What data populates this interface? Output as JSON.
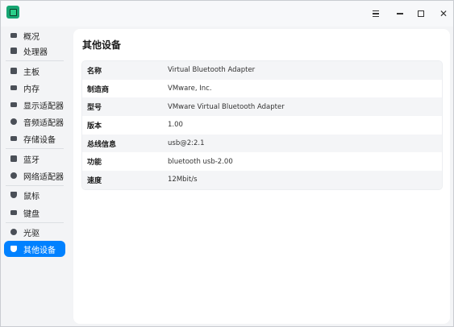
{
  "sidebar": {
    "items": [
      {
        "label": "概况",
        "icon": "overview-icon"
      },
      {
        "label": "处理器",
        "icon": "cpu-icon"
      },
      {
        "label": "主板",
        "icon": "motherboard-icon"
      },
      {
        "label": "内存",
        "icon": "memory-icon"
      },
      {
        "label": "显示适配器",
        "icon": "display-adapter-icon"
      },
      {
        "label": "音频适配器",
        "icon": "audio-adapter-icon"
      },
      {
        "label": "存储设备",
        "icon": "storage-icon"
      },
      {
        "label": "蓝牙",
        "icon": "bluetooth-icon"
      },
      {
        "label": "网络适配器",
        "icon": "network-adapter-icon"
      },
      {
        "label": "鼠标",
        "icon": "mouse-icon"
      },
      {
        "label": "键盘",
        "icon": "keyboard-icon"
      },
      {
        "label": "光驱",
        "icon": "optical-drive-icon"
      },
      {
        "label": "其他设备",
        "icon": "other-devices-icon"
      }
    ],
    "selected": "其他设备"
  },
  "main": {
    "title": "其他设备",
    "rows": [
      {
        "key": "名称",
        "value": "Virtual Bluetooth Adapter"
      },
      {
        "key": "制造商",
        "value": "VMware, Inc."
      },
      {
        "key": "型号",
        "value": "VMware Virtual Bluetooth Adapter"
      },
      {
        "key": "版本",
        "value": "1.00"
      },
      {
        "key": "总线信息",
        "value": "usb@2:2.1"
      },
      {
        "key": "功能",
        "value": "bluetooth usb-2.00"
      },
      {
        "key": "速度",
        "value": "12Mbit/s"
      }
    ]
  },
  "colors": {
    "accent": "#0081ff",
    "app_icon": "#17a673"
  }
}
